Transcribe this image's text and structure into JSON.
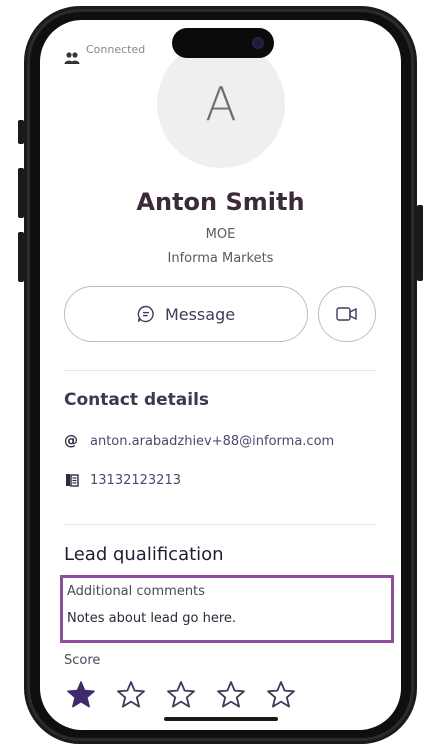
{
  "profile": {
    "connected_label": "Connected",
    "avatar_initial": "A",
    "name": "Anton Smith",
    "role": "MOE",
    "company": "Informa Markets"
  },
  "actions": {
    "message_label": "Message"
  },
  "contact": {
    "section_title": "Contact details",
    "email": "anton.arabadzhiev+88@informa.com",
    "email_symbol": "@",
    "phone": "13132123213"
  },
  "lead": {
    "section_title": "Lead qualification",
    "comments_label": "Additional comments",
    "comments_value": "Notes about lead go here.",
    "score_label": "Score",
    "score_value": 1,
    "score_max": 5
  },
  "colors": {
    "accent": "#3f2a6b",
    "highlight_border": "#8c4f9a",
    "star_outline": "#3f3c5a"
  }
}
